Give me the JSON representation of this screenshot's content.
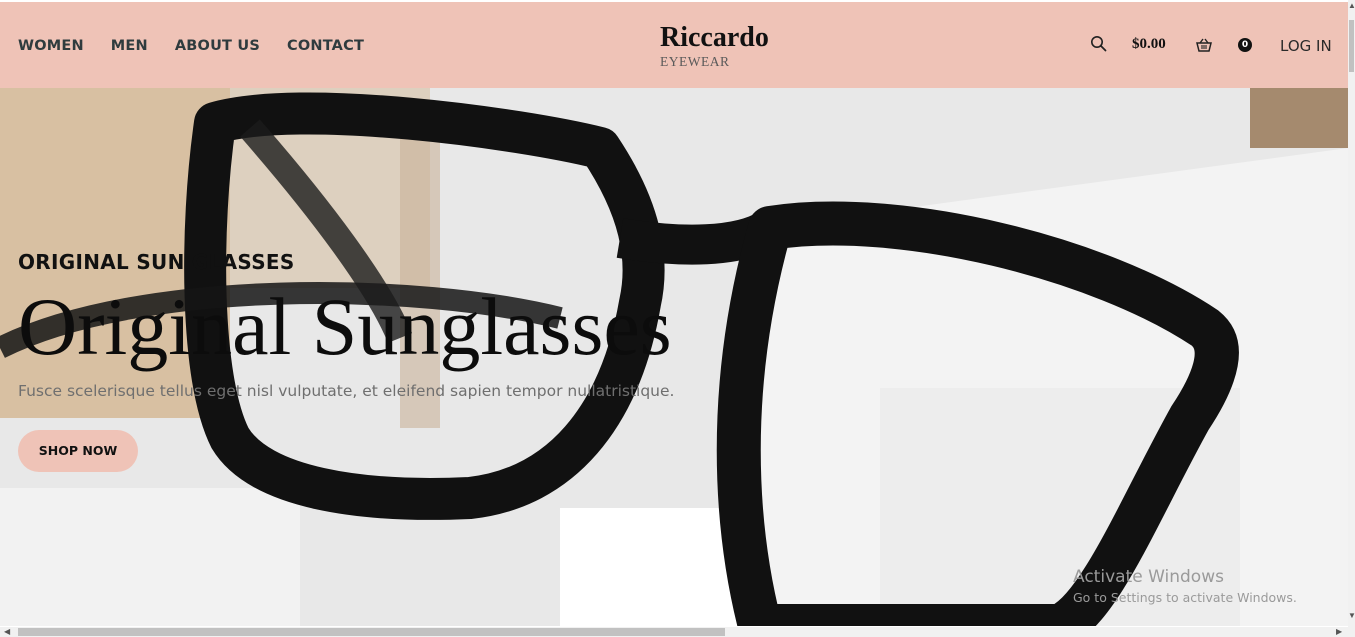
{
  "nav": {
    "items": [
      {
        "label": "WOMEN"
      },
      {
        "label": "MEN"
      },
      {
        "label": "ABOUT US"
      },
      {
        "label": "CONTACT"
      }
    ]
  },
  "brand": {
    "name": "Riccardo",
    "tagline": "EYEWEAR"
  },
  "header": {
    "search_icon": "search-icon",
    "cart_total": "$0.00",
    "basket_icon": "basket-icon",
    "cart_count": "0",
    "login_label": "LOG IN"
  },
  "hero": {
    "eyebrow": "ORIGINAL SUN GLASSES",
    "headline": "Original Sunglasses",
    "description": "Fusce scelerisque tellus eget nisl vulputate, et eleifend sapien tempor nullatristique.",
    "cta_label": "SHOP NOW"
  },
  "watermark": {
    "title": "Activate Windows",
    "subtitle": "Go to Settings to activate Windows."
  },
  "colors": {
    "header_bg": "#efc3b7",
    "button_bg": "#efc3b7",
    "text_dark": "#111111"
  }
}
